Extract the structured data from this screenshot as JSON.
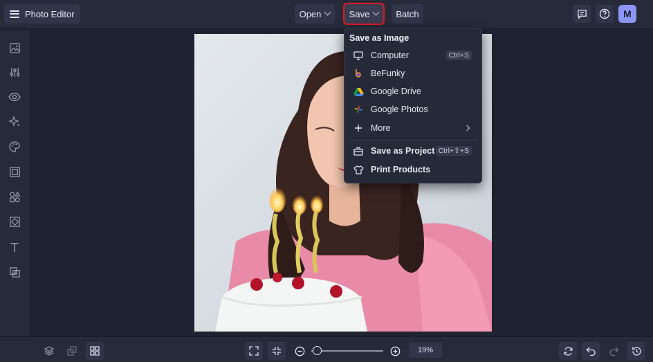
{
  "app": {
    "title": "Photo Editor"
  },
  "toolbar": {
    "open_label": "Open",
    "save_label": "Save",
    "batch_label": "Batch",
    "avatar_initial": "M"
  },
  "save_menu": {
    "header": "Save as Image",
    "items": [
      {
        "label": "Computer",
        "icon": "monitor-icon",
        "shortcut": "Ctrl+S"
      },
      {
        "label": "BeFunky",
        "icon": "befunky-icon"
      },
      {
        "label": "Google Drive",
        "icon": "google-drive-icon"
      },
      {
        "label": "Google Photos",
        "icon": "google-photos-icon"
      },
      {
        "label": "More",
        "icon": "plus-icon"
      },
      {
        "label": "Save as Project",
        "icon": "briefcase-icon",
        "shortcut": "Ctrl+⇧+S"
      },
      {
        "label": "Print Products",
        "icon": "tshirt-icon"
      }
    ]
  },
  "sidebar": {
    "items": [
      {
        "name": "image-manager-icon"
      },
      {
        "name": "edit-sliders-icon"
      },
      {
        "name": "eye-icon"
      },
      {
        "name": "sparkle-icon"
      },
      {
        "name": "palette-icon"
      },
      {
        "name": "frame-icon"
      },
      {
        "name": "shapes-icon"
      },
      {
        "name": "texture-icon"
      },
      {
        "name": "text-icon"
      },
      {
        "name": "overlay-icon"
      }
    ]
  },
  "bottom": {
    "zoom_text": "19%"
  },
  "colors": {
    "accent_highlight": "#e01822",
    "avatar_bg": "#8c95f4",
    "background": "#1f2230",
    "panel": "#272a38"
  }
}
